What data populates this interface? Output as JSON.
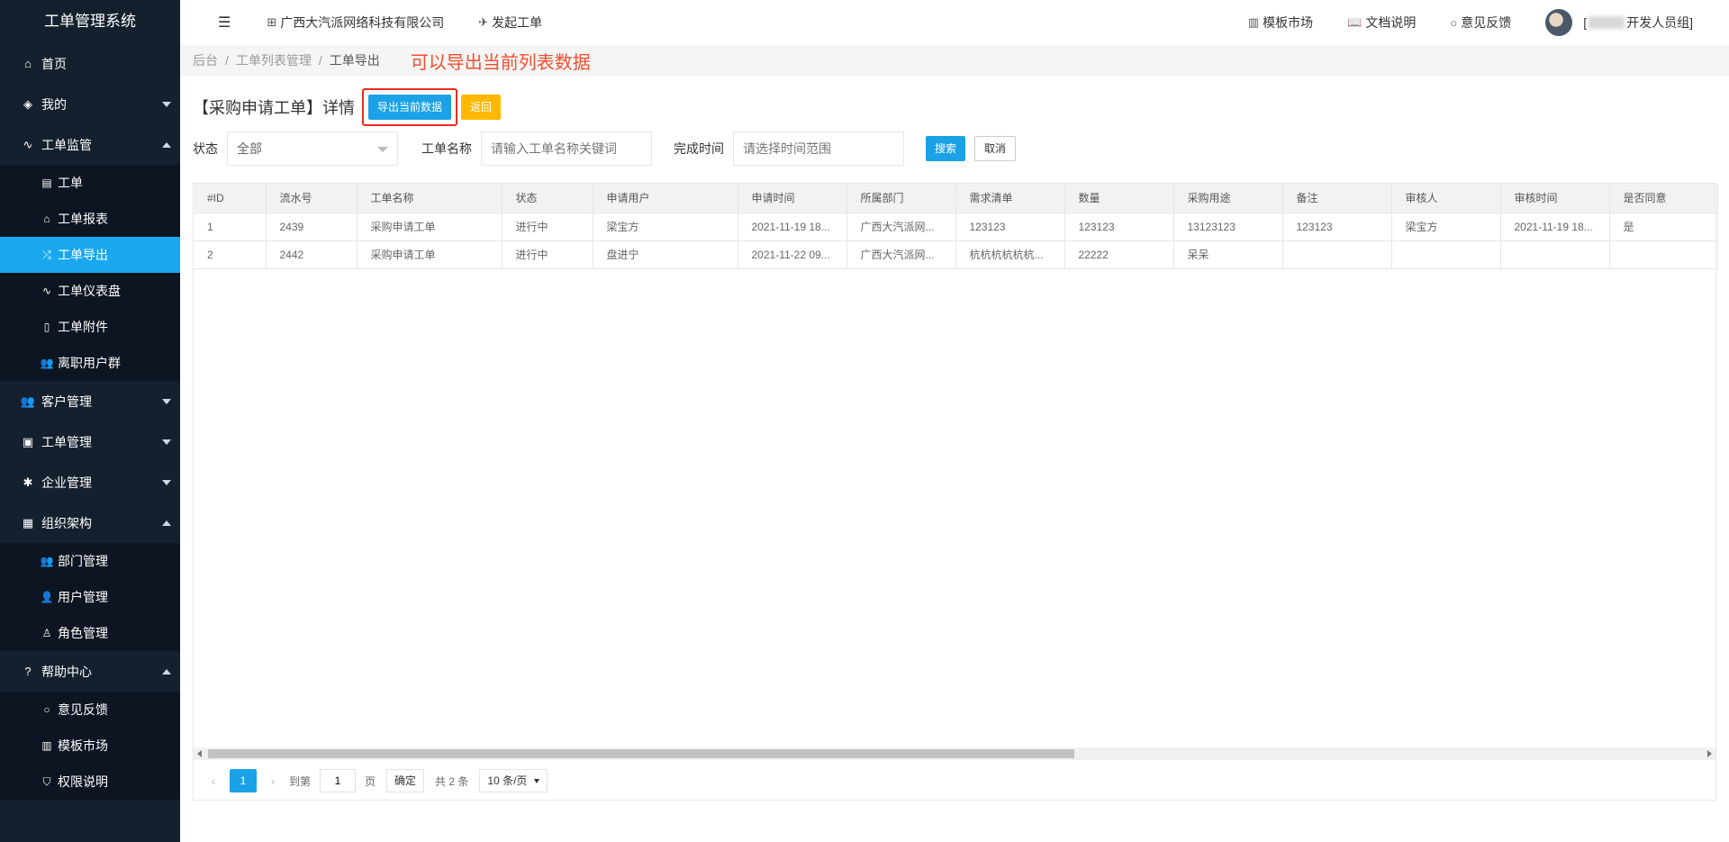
{
  "app_title": "工单管理系统",
  "sidebar": {
    "items": [
      {
        "label": "首页",
        "icon": "home-icon"
      },
      {
        "label": "我的",
        "icon": "layers-icon"
      },
      {
        "label": "工单监管",
        "icon": "pulse-icon"
      },
      {
        "label": "客户管理",
        "icon": "users-icon"
      },
      {
        "label": "工单管理",
        "icon": "clipboard-icon"
      },
      {
        "label": "企业管理",
        "icon": "gear-icon"
      },
      {
        "label": "组织架构",
        "icon": "calendar-icon"
      },
      {
        "label": "帮助中心",
        "icon": "question-icon"
      }
    ],
    "monitor_sub": [
      {
        "label": "工单"
      },
      {
        "label": "工单报表"
      },
      {
        "label": "工单导出"
      },
      {
        "label": "工单仪表盘"
      },
      {
        "label": "工单附件"
      },
      {
        "label": "离职用户群"
      }
    ],
    "org_sub": [
      {
        "label": "部门管理"
      },
      {
        "label": "用户管理"
      },
      {
        "label": "角色管理"
      }
    ],
    "help_sub": [
      {
        "label": "意见反馈"
      },
      {
        "label": "模板市场"
      },
      {
        "label": "权限说明"
      }
    ]
  },
  "topbar": {
    "company": "广西大汽派网络科技有限公司",
    "launch": "发起工单",
    "template_market": "模板市场",
    "docs": "文档说明",
    "feedback": "意见反馈",
    "user_prefix": "[",
    "user_suffix": "开发人员组]"
  },
  "breadcrumb": {
    "items": [
      "后台",
      "工单列表管理",
      "工单导出"
    ],
    "note": "可以导出当前列表数据"
  },
  "page": {
    "title": "【采购申请工单】详情",
    "export_button": "导出当前数据",
    "back_button": "返回"
  },
  "filters": {
    "status_label": "状态",
    "status_value": "全部",
    "name_label": "工单名称",
    "name_placeholder": "请输入工单名称关键词",
    "time_label": "完成时间",
    "time_placeholder": "请选择时间范围",
    "search_button": "搜索",
    "cancel_button": "取消"
  },
  "table": {
    "headers": [
      "#ID",
      "流水号",
      "工单名称",
      "状态",
      "申请用户",
      "申请时间",
      "所属部门",
      "需求清单",
      "数量",
      "采购用途",
      "备注",
      "审核人",
      "审核时间",
      "是否同意"
    ],
    "rows": [
      [
        "1",
        "2439",
        "采购申请工单",
        "进行中",
        "梁宝方",
        "2021-11-19 18...",
        "广西大汽派网...",
        "123123",
        "123123",
        "13123123",
        "123123",
        "梁宝方",
        "2021-11-19 18...",
        "是"
      ],
      [
        "2",
        "2442",
        "采购申请工单",
        "进行中",
        "盘进宁",
        "2021-11-22 09...",
        "广西大汽派网...",
        "杭杭杭杭杭杭...",
        "22222",
        "呆呆",
        "",
        "",
        "",
        ""
      ]
    ]
  },
  "pagination": {
    "current_page": "1",
    "goto_label": "到第",
    "page_input": "1",
    "page_unit": "页",
    "confirm": "确定",
    "total": "共 2 条",
    "page_size": "10 条/页"
  }
}
